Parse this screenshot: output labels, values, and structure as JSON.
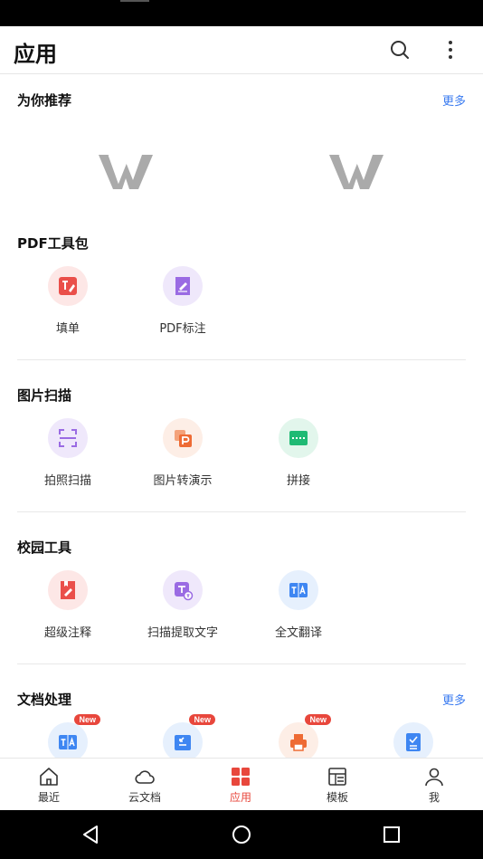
{
  "header": {
    "title": "应用"
  },
  "recommend": {
    "title": "为你推荐",
    "more": "更多"
  },
  "pdf": {
    "title": "PDF工具包",
    "items": [
      {
        "label": "填单"
      },
      {
        "label": "PDF标注"
      }
    ]
  },
  "scan": {
    "title": "图片扫描",
    "items": [
      {
        "label": "拍照扫描"
      },
      {
        "label": "图片转演示"
      },
      {
        "label": "拼接"
      }
    ]
  },
  "campus": {
    "title": "校园工具",
    "items": [
      {
        "label": "超级注释"
      },
      {
        "label": "扫描提取文字"
      },
      {
        "label": "全文翻译"
      }
    ]
  },
  "docs": {
    "title": "文档处理",
    "more": "更多",
    "badge": "New"
  },
  "nav": {
    "items": [
      {
        "label": "最近"
      },
      {
        "label": "云文档"
      },
      {
        "label": "应用"
      },
      {
        "label": "模板"
      },
      {
        "label": "我"
      }
    ]
  },
  "colors": {
    "accent": "#e8473c",
    "link": "#3a7bf0"
  }
}
